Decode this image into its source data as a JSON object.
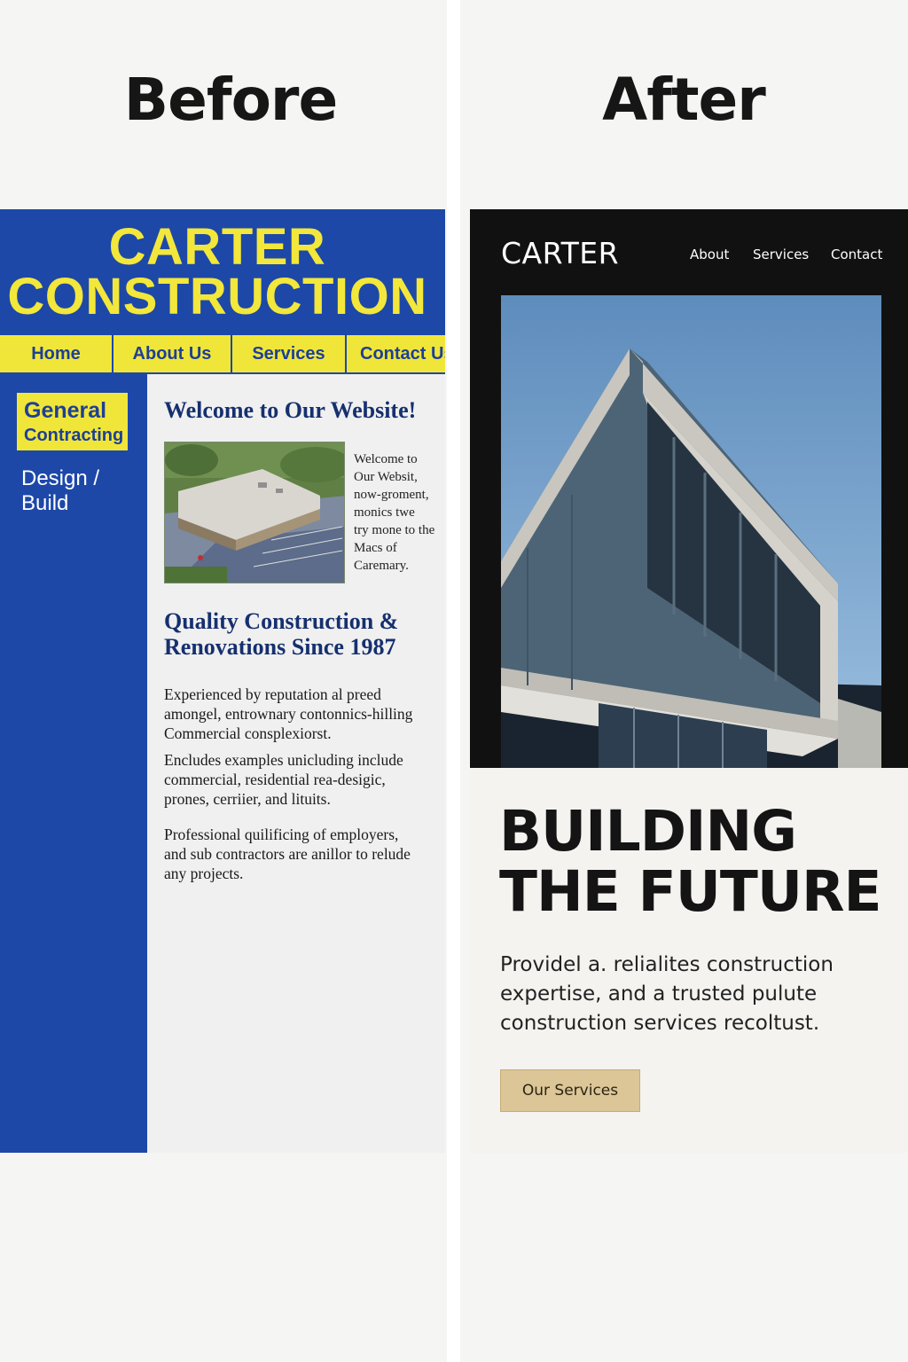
{
  "before": {
    "heading": "Before",
    "logo": {
      "line1": "CARTER",
      "line2": "CONSTRUCTION"
    },
    "nav": [
      "Home",
      "About Us",
      "Services",
      "Contact Us"
    ],
    "sidebar": {
      "box_line1": "General",
      "box_line2": "Contracting",
      "item": "Design / Build"
    },
    "welcome_title": "Welcome to Our Website!",
    "photo_caption": [
      "Welcome to",
      "Our Websit,",
      "now-groment,",
      "monics twe",
      "try mone to the",
      "Macs of",
      "Caremary."
    ],
    "section_title": "Quality Construction & Renovations Since 1987",
    "paragraphs": [
      [
        "Experienced by reputation al preed",
        "amongel, entrownary contonnics-hilling",
        "Commercial consplexiorst."
      ],
      [
        "Encludes examples unicluding include",
        "commercial, residential rea-desigic,",
        "prones, cerriier, and lituits."
      ],
      [
        "Professional quilificing of employers,",
        "and sub contractors are anillor to relude",
        "any projects."
      ]
    ],
    "colors": {
      "primary": "#1d48a8",
      "accent": "#f0e63a"
    }
  },
  "after": {
    "heading": "After",
    "logo": "CARTER",
    "nav": [
      "About",
      "Services",
      "Contact"
    ],
    "headline": [
      "BUILDING",
      "THE FUTURE"
    ],
    "body": [
      "Providel a. relialites construction",
      "expertise, and a trusted pulute",
      "construction services recoltust."
    ],
    "cta": "Our Services",
    "colors": {
      "dark": "#111111",
      "cta": "#dcc697"
    }
  }
}
